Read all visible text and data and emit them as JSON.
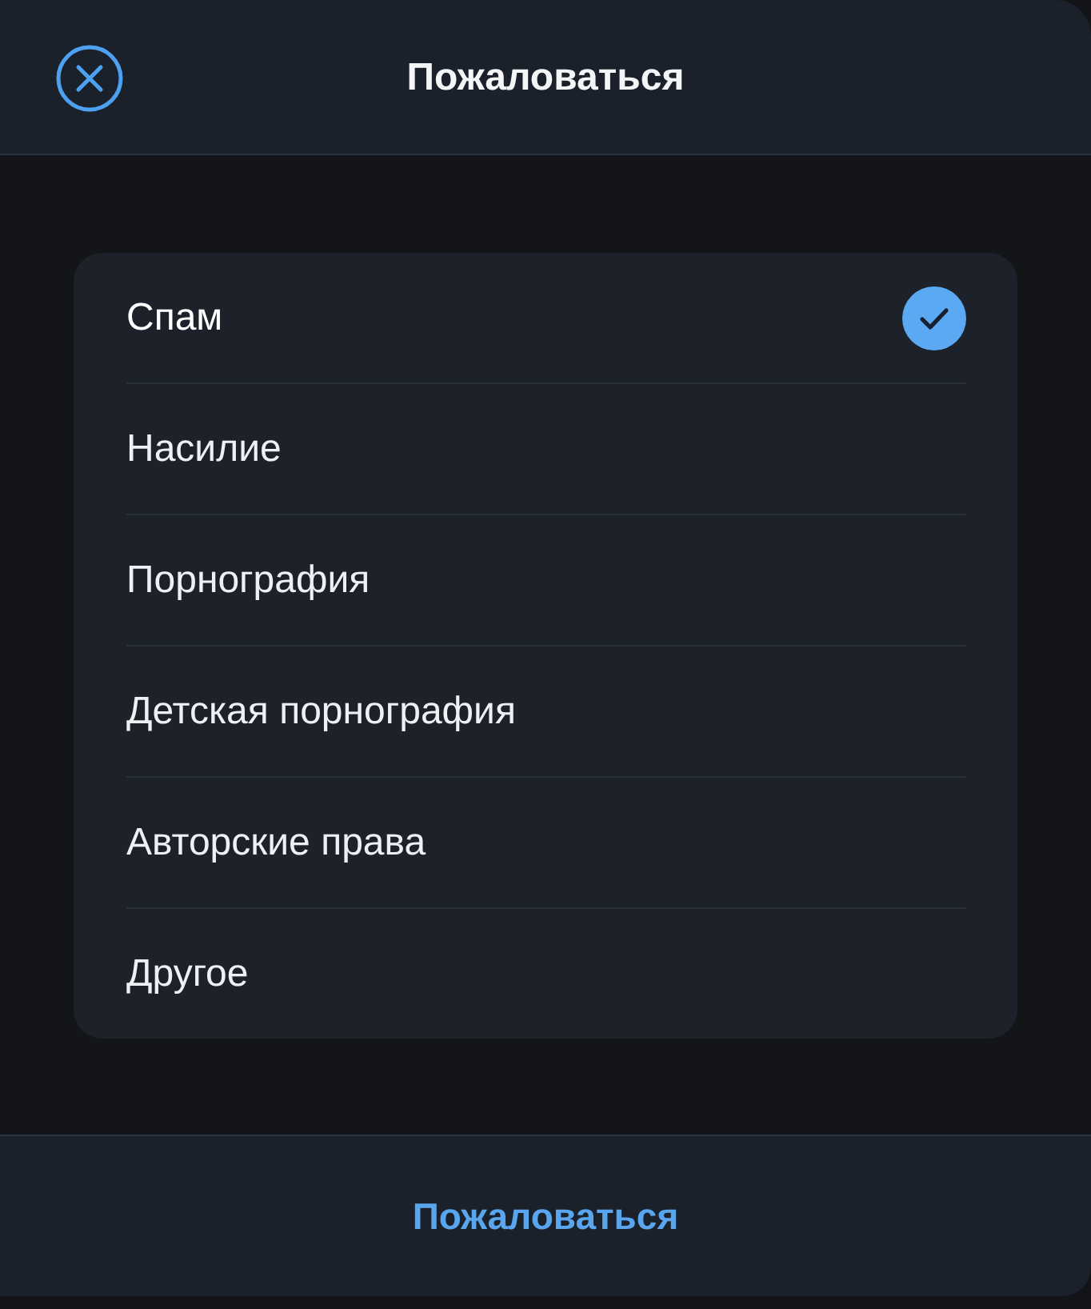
{
  "header": {
    "title": "Пожаловаться"
  },
  "reasons": [
    {
      "label": "Спам",
      "selected": true
    },
    {
      "label": "Насилие",
      "selected": false
    },
    {
      "label": "Порнография",
      "selected": false
    },
    {
      "label": "Детская порнография",
      "selected": false
    },
    {
      "label": "Авторские права",
      "selected": false
    },
    {
      "label": "Другое",
      "selected": false
    }
  ],
  "footer": {
    "submit_label": "Пожаловаться"
  }
}
